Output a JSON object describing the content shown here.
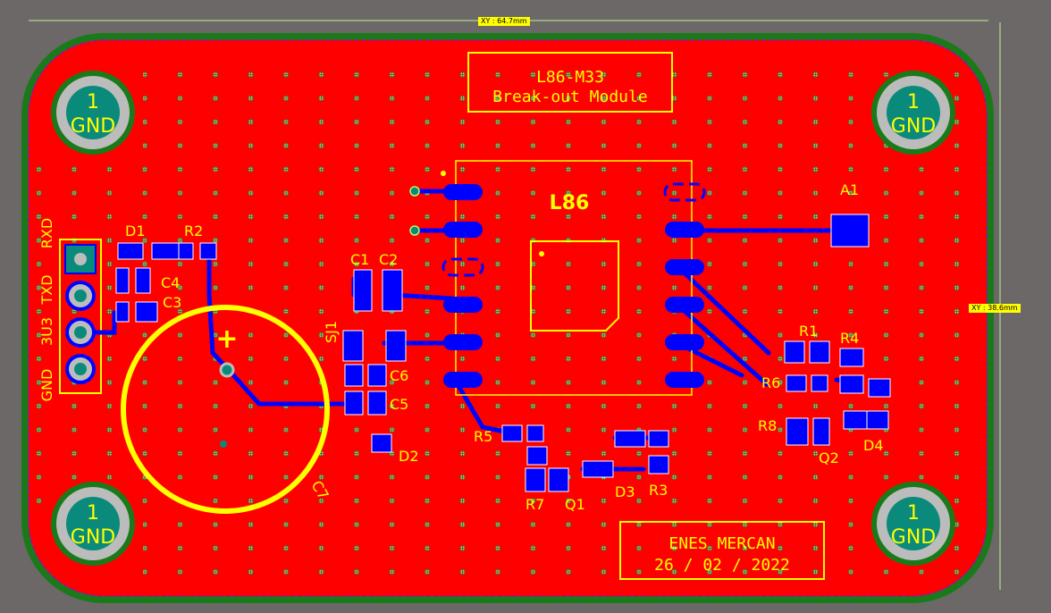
{
  "dimensions": {
    "width_label": "XY : 64.7mm",
    "height_label": "XY : 38.6mm"
  },
  "title_box": {
    "line1": "L86-M33",
    "line2": "Break-out Module"
  },
  "author_box": {
    "line1": "ENES MERCAN",
    "line2": "26 / 02 / 2022"
  },
  "module_label": "L86",
  "mounting_holes": [
    {
      "pin": "1",
      "net": "GND"
    },
    {
      "pin": "1",
      "net": "GND"
    },
    {
      "pin": "1",
      "net": "GND"
    },
    {
      "pin": "1",
      "net": "GND"
    }
  ],
  "header_pins": [
    "RXD",
    "TXD",
    "3U3",
    "GND"
  ],
  "designators": {
    "D1": "D1",
    "R2": "R2",
    "C4": "C4",
    "C3": "C3",
    "C1": "C1",
    "C2": "C2",
    "SJ1": "SJ1",
    "C6": "C6",
    "C5": "C5",
    "D2": "D2",
    "C7": "C7",
    "R5": "R5",
    "R7": "R7",
    "Q1": "Q1",
    "D3": "D3",
    "R3": "R3",
    "A1": "A1",
    "R1": "R1",
    "R4": "R4",
    "R6": "R6",
    "R8": "R8",
    "Q2": "Q2",
    "D4": "D4"
  },
  "battery_plus": "+",
  "colors": {
    "background": "#6b6867",
    "copper_top": "#ff0000",
    "copper_bottom": "#0000ff",
    "silkscreen": "#ffff00",
    "board_outline": "#1a7a1a",
    "pad_gray": "#bcbcbc",
    "hole_teal": "#0a8a7a"
  }
}
